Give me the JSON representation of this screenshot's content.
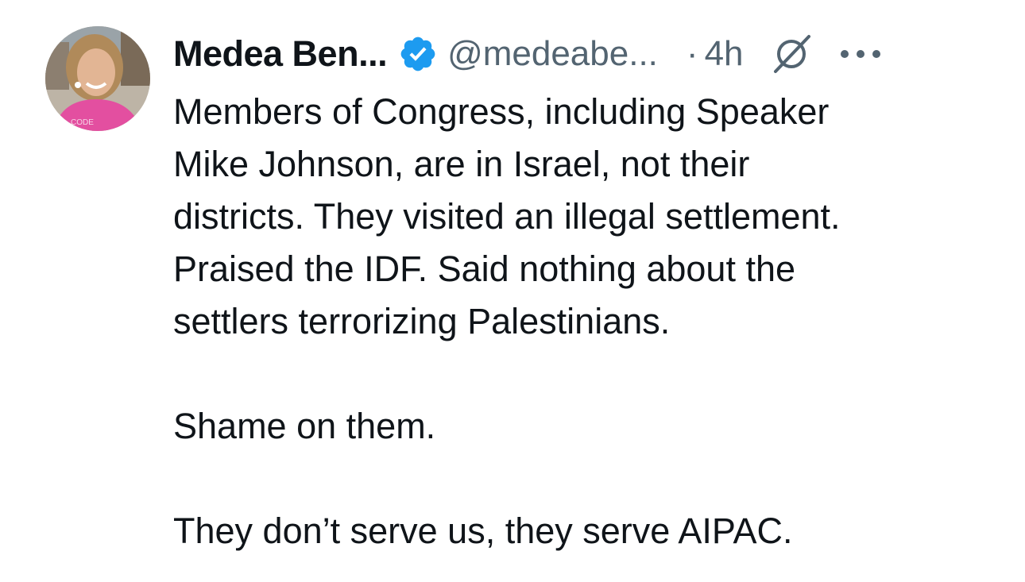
{
  "tweet": {
    "author": {
      "display_name": "Medea Ben...",
      "handle": "@medeabe...",
      "verified": true,
      "avatar_shirt_text": "CODE"
    },
    "meta": {
      "separator": "·",
      "time": "4h"
    },
    "icons": {
      "verified": "verified-badge-icon",
      "grok": "grok-icon",
      "more": "more-options-icon"
    },
    "colors": {
      "verified_blue": "#1d9bf0",
      "secondary_text": "#536471",
      "primary_text": "#0f1419"
    },
    "body": {
      "paragraph1": {
        "line1": "Members of Congress, including Speaker",
        "line2": "Mike Johnson, are in Israel, not their",
        "line3": "districts. They visited an illegal settlement.",
        "line4": "Praised the IDF. Said nothing about the",
        "line5": "settlers terrorizing Palestinians."
      },
      "paragraph2": "Shame on them.",
      "paragraph3": "They don’t serve us, they serve AIPAC."
    }
  }
}
